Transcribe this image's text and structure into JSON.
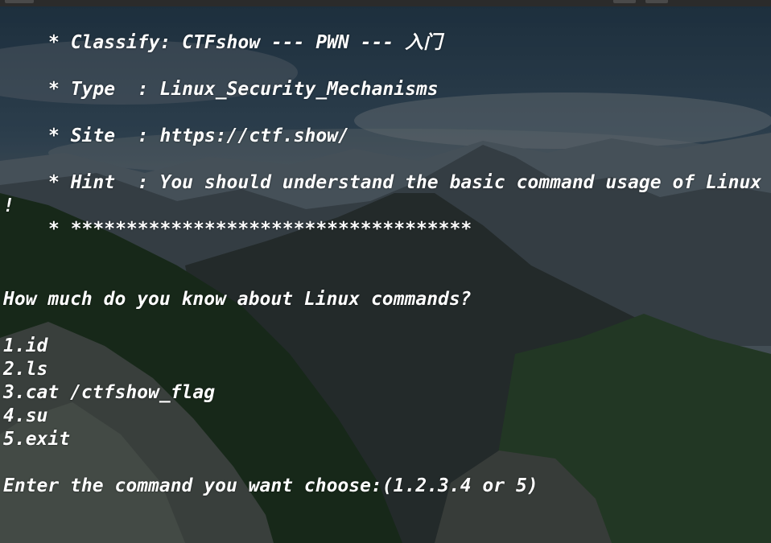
{
  "banner": {
    "classify": "* Classify: CTFshow --- PWN --- 入门",
    "type": "* Type  : Linux_Security_Mechanisms",
    "site": "* Site  : https://ctf.show/",
    "hint": "* Hint  : You should understand the basic command usage of Linux",
    "hint_wrap": "!",
    "stars": "* ************************************"
  },
  "prompt": {
    "question": "How much do you know about Linux commands?",
    "options": [
      "1.id",
      "2.ls",
      "3.cat /ctfshow_flag",
      "4.su",
      "5.exit"
    ],
    "input_prompt": "Enter the command you want choose:(1.2.3.4 or 5)"
  },
  "colors": {
    "text": "#ffffff",
    "sky_top": "#27404f",
    "mountain": "#2f3d3e"
  }
}
